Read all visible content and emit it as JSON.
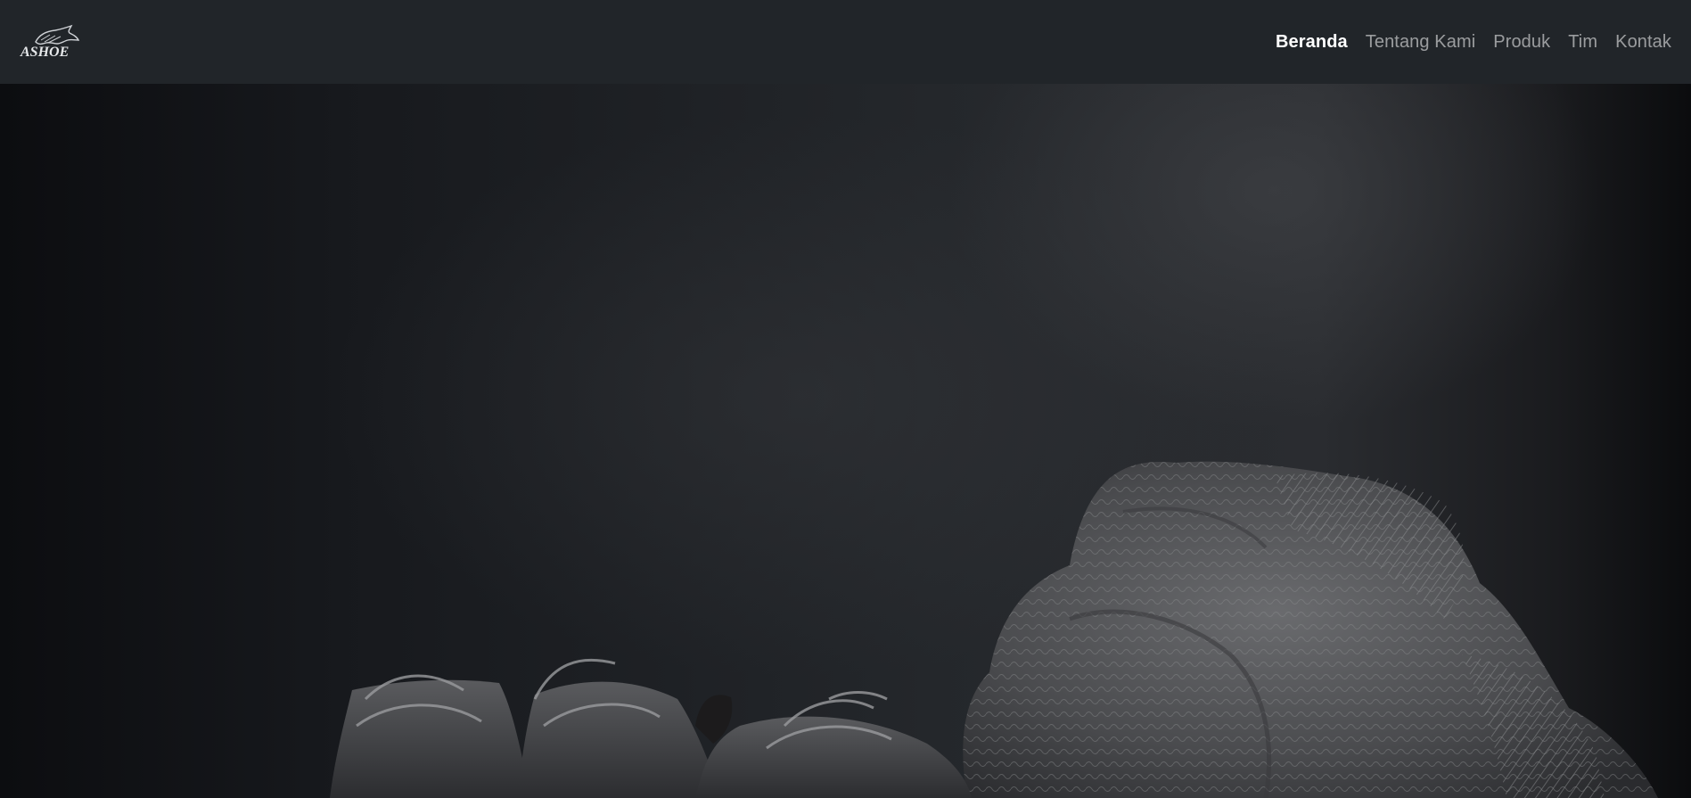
{
  "brand": {
    "logo_text": "ASHOE",
    "logo_icon": "horse-head-icon"
  },
  "nav": {
    "items": [
      {
        "label": "Beranda",
        "active": true
      },
      {
        "label": "Tentang Kami",
        "active": false
      },
      {
        "label": "Produk",
        "active": false
      },
      {
        "label": "Tim",
        "active": false
      },
      {
        "label": "Kontak",
        "active": false
      }
    ]
  },
  "hero": {
    "image": "hero-sneakers-and-knit-sweater-photo",
    "colors": {
      "navbar_bg": "#212529",
      "hero_dark": "#0c0d10",
      "hero_mid": "#2a2c30"
    }
  }
}
